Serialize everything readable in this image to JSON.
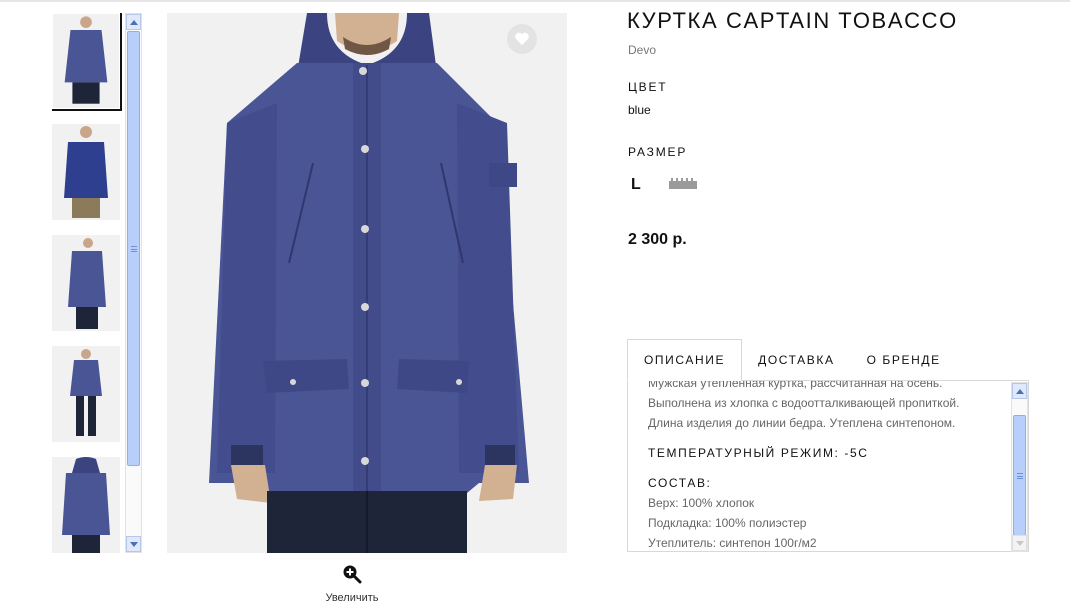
{
  "product": {
    "title": "КУРТКА CAPTAIN TOBACCO",
    "brand": "Devo",
    "color_label": "ЦВЕТ",
    "color_value": "blue",
    "size_label": "РАЗМЕР",
    "size_value": "L",
    "price": "2 300 р."
  },
  "gallery": {
    "zoom_label": "Увеличить"
  },
  "tabs": [
    {
      "label": "ОПИСАНИЕ"
    },
    {
      "label": "ДОСТАВКА"
    },
    {
      "label": "О БРЕНДЕ"
    }
  ],
  "description": {
    "lines": [
      "Мужская утепленная куртка, рассчитанная на осень.",
      "Выполнена из хлопка с водоотталкивающей пропиткой.",
      "Длина изделия до линии бедра. Утеплена синтепоном."
    ],
    "temperature": "ТЕМПЕРАТУРНЫЙ РЕЖИМ: -5С",
    "composition_title": "СОСТАВ:",
    "composition": [
      "Верх: 100% хлопок",
      "Подкладка: 100% полиэстер",
      "Утеплитель: синтепон 100г/м2"
    ]
  },
  "colors": {
    "jacket": "#4a5596",
    "jacket_dark": "#3b4480",
    "jeans": "#1f2538",
    "bg": "#f1f1f1",
    "scroll_thumb": "#b8cffb"
  },
  "icons": {
    "favorite": "heart-icon",
    "zoom": "zoom-in-icon",
    "size_chart": "ruler-icon"
  }
}
